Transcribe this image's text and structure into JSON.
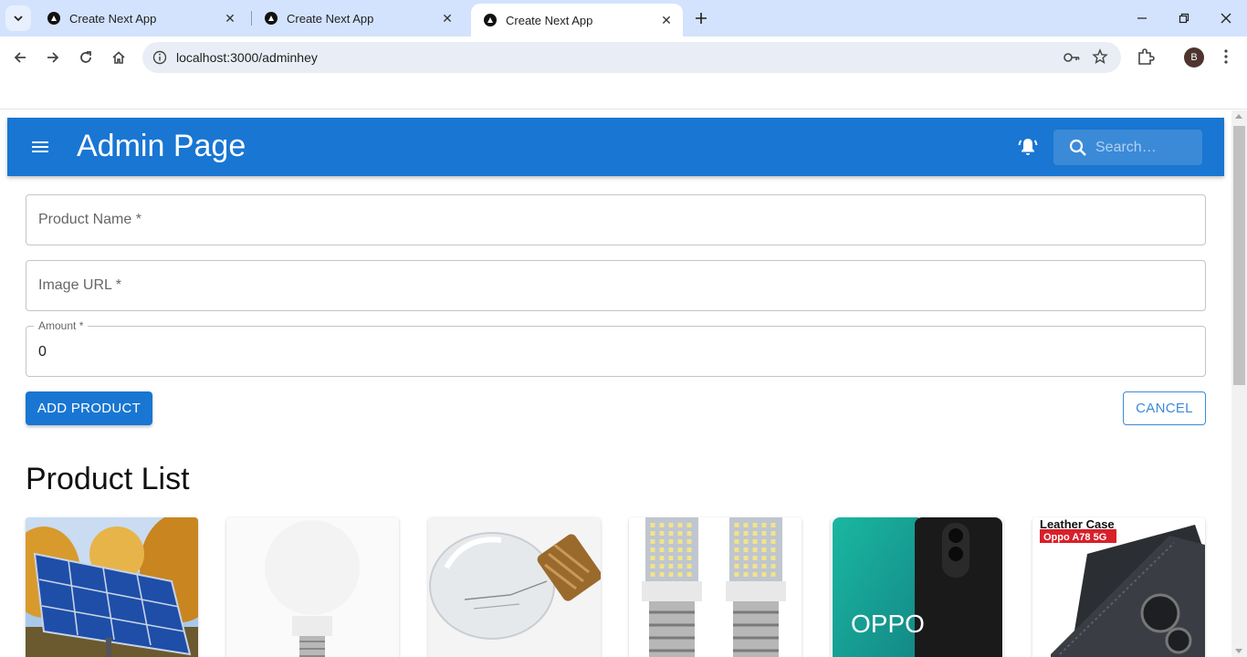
{
  "browser": {
    "tabs": [
      {
        "title": "Create Next App",
        "active": false
      },
      {
        "title": "Create Next App",
        "active": false
      },
      {
        "title": "Create Next App",
        "active": true
      }
    ],
    "url": "localhost:3000/adminhey",
    "profile_initial": "B"
  },
  "appbar": {
    "title": "Admin Page",
    "search_placeholder": "Search…"
  },
  "form": {
    "product_name_label": "Product Name *",
    "image_url_label": "Image URL *",
    "amount_label": "Amount *",
    "amount_value": "0",
    "add_button": "ADD PRODUCT",
    "cancel_button": "CANCEL"
  },
  "products": {
    "heading": "Product List",
    "items": [
      {
        "image": "solar-panel"
      },
      {
        "image": "led-bulb"
      },
      {
        "image": "incandescent-bulb"
      },
      {
        "image": "led-corn-bulbs"
      },
      {
        "image": "oppo-phone",
        "image_text": "OPPO"
      },
      {
        "image": "leather-case",
        "image_text": [
          "Leather Case",
          "Oppo A78 5G"
        ]
      }
    ]
  },
  "colors": {
    "primary": "#1976d2",
    "tabbar": "#d3e3fd"
  }
}
